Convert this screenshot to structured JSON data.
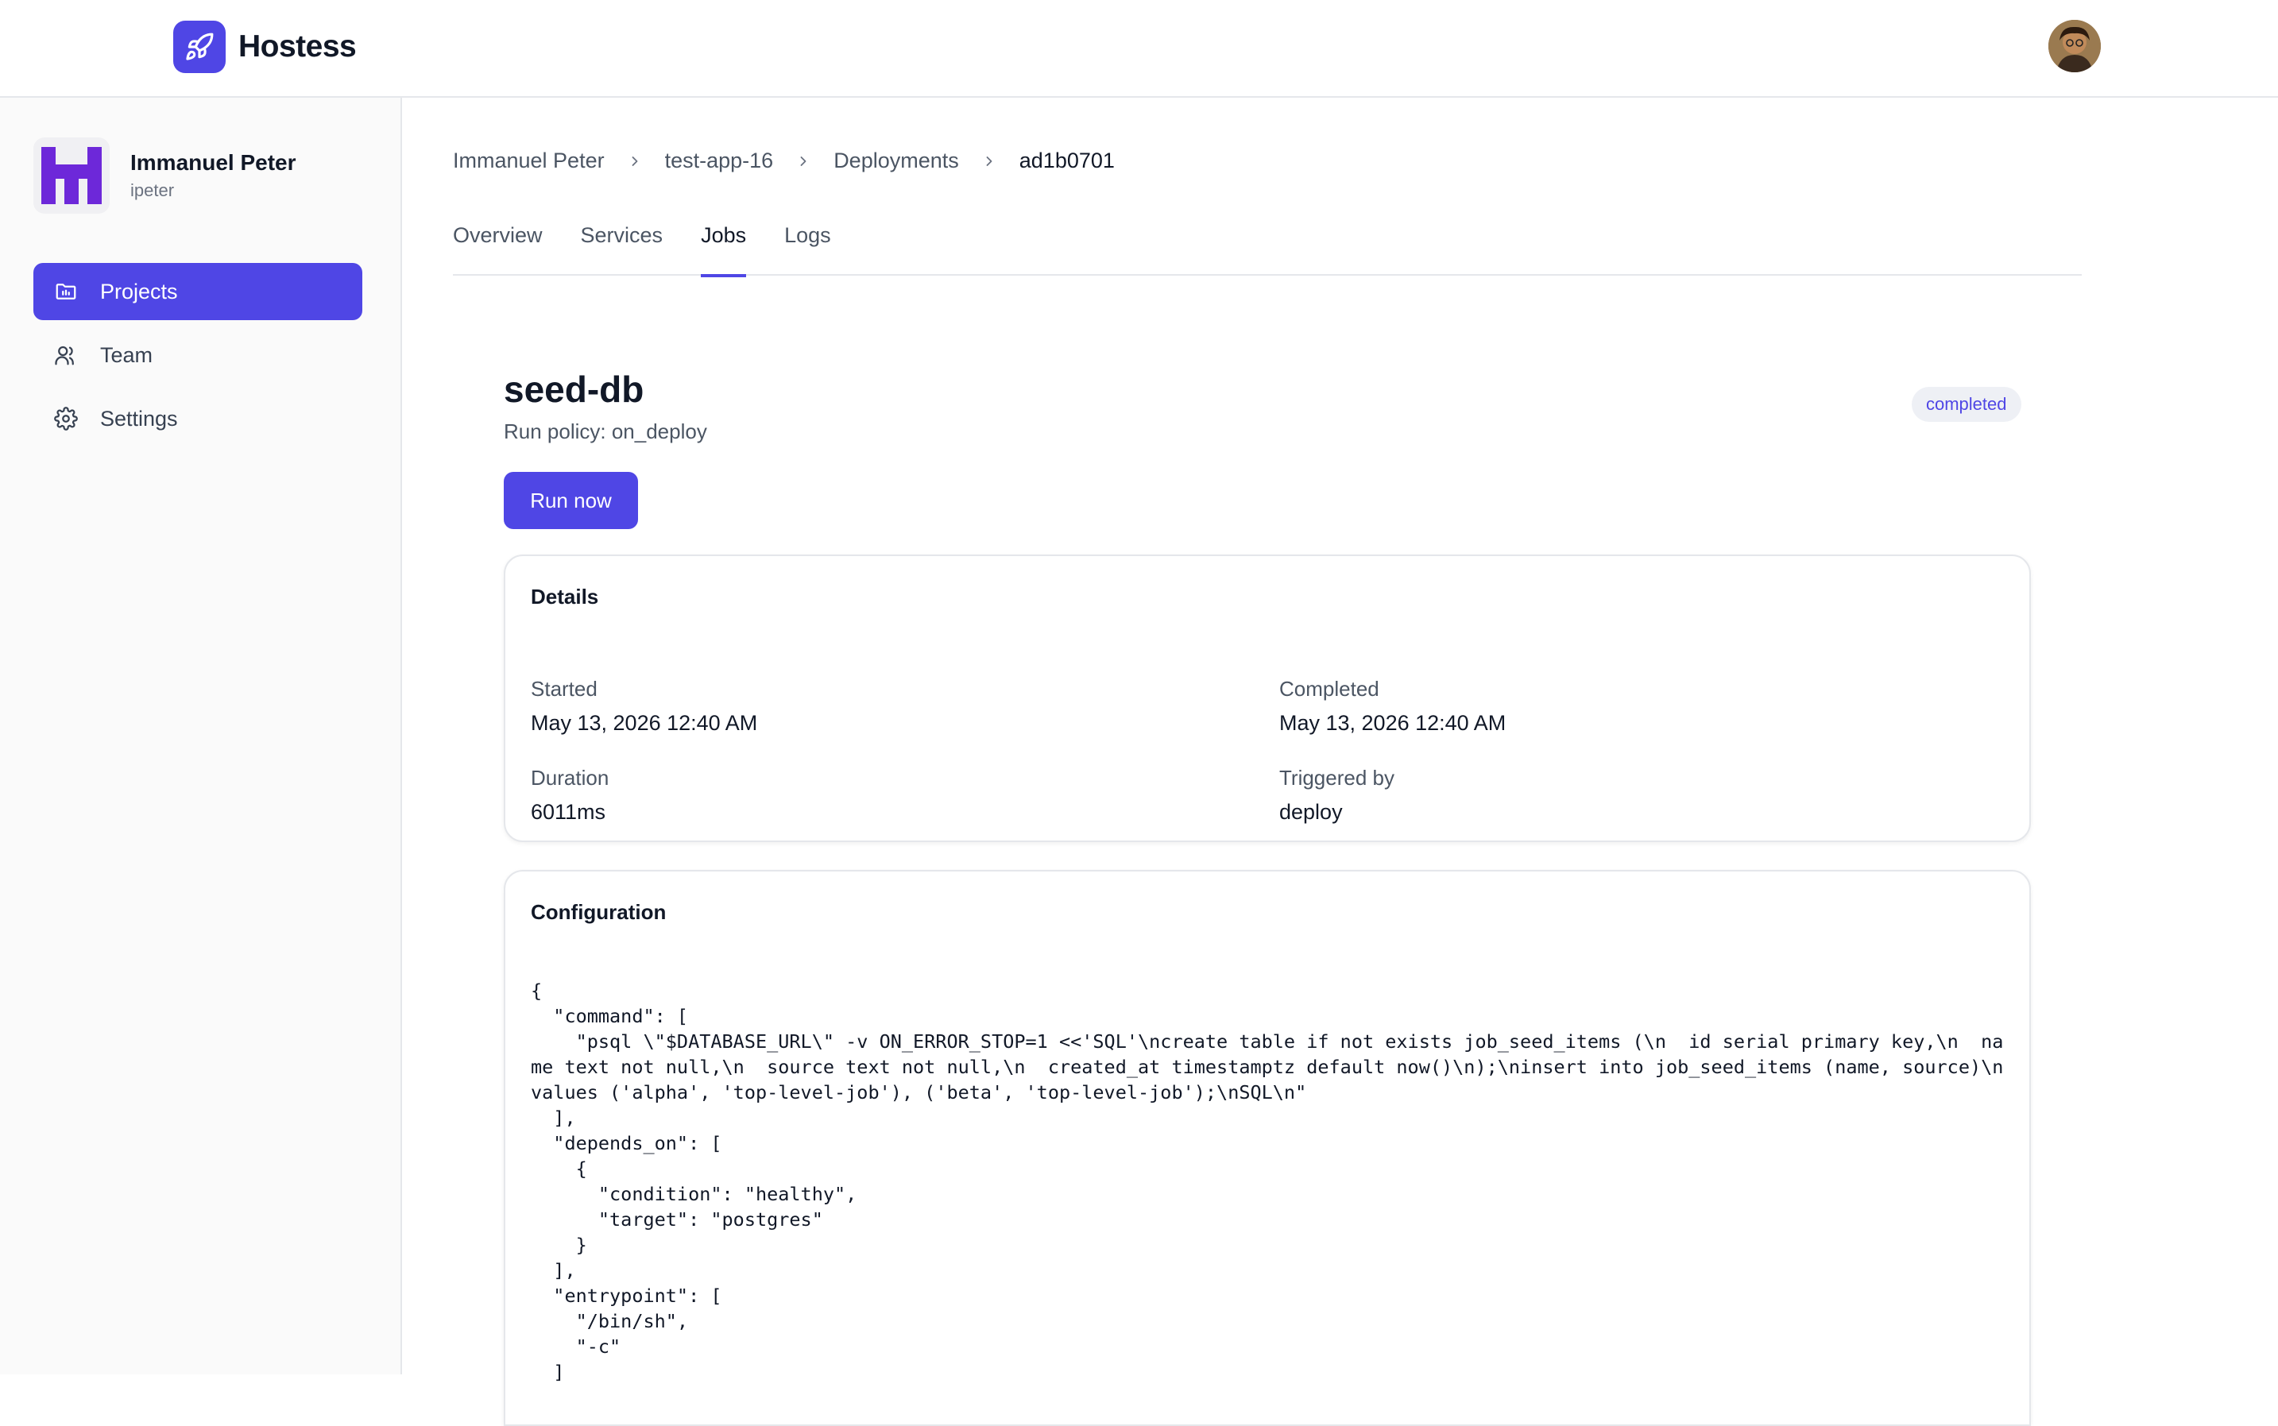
{
  "app": {
    "name": "Hostess",
    "colors": {
      "accent": "#4f46e5",
      "badge_bg": "#eef0f5"
    },
    "logo_icon": "rocket-icon"
  },
  "org": {
    "name": "Immanuel Peter",
    "handle": "ipeter"
  },
  "sidebar": {
    "items": [
      {
        "label": "Projects",
        "icon": "folder-icon",
        "active": true
      },
      {
        "label": "Team",
        "icon": "users-icon",
        "active": false
      },
      {
        "label": "Settings",
        "icon": "gear-icon",
        "active": false
      }
    ]
  },
  "breadcrumb": [
    {
      "label": "Immanuel Peter"
    },
    {
      "label": "test-app-16"
    },
    {
      "label": "Deployments"
    },
    {
      "label": "ad1b0701"
    }
  ],
  "tabs": [
    {
      "label": "Overview",
      "active": false
    },
    {
      "label": "Services",
      "active": false
    },
    {
      "label": "Jobs",
      "active": true
    },
    {
      "label": "Logs",
      "active": false
    }
  ],
  "job": {
    "name": "seed-db",
    "run_policy": "Run policy: on_deploy",
    "status": "completed",
    "run_button": "Run now"
  },
  "details": {
    "title": "Details",
    "started_label": "Started",
    "started_value": "May 13, 2026 12:40 AM",
    "completed_label": "Completed",
    "completed_value": "May 13, 2026 12:40 AM",
    "duration_label": "Duration",
    "duration_value": "6011ms",
    "triggered_label": "Triggered by",
    "triggered_value": "deploy"
  },
  "configuration": {
    "title": "Configuration",
    "json": "{\n  \"command\": [\n    \"psql \\\"$DATABASE_URL\\\" -v ON_ERROR_STOP=1 <<'SQL'\\ncreate table if not exists job_seed_items (\\n  id serial primary key,\\n  name text not null,\\n  source text not null,\\n  created_at timestamptz default now()\\n);\\ninsert into job_seed_items (name, source)\\nvalues ('alpha', 'top-level-job'), ('beta', 'top-level-job');\\nSQL\\n\"\n  ],\n  \"depends_on\": [\n    {\n      \"condition\": \"healthy\",\n      \"target\": \"postgres\"\n    }\n  ],\n  \"entrypoint\": [\n    \"/bin/sh\",\n    \"-c\"\n  ]"
  }
}
